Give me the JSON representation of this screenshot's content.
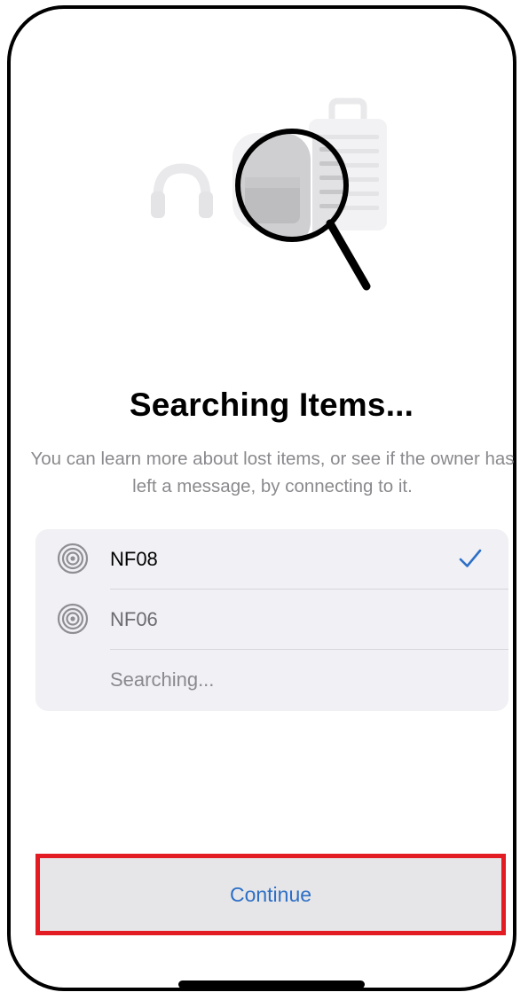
{
  "screen": {
    "title": "Searching Items...",
    "description": "You can learn more about lost items, or see if the owner has left a message, by connecting to it."
  },
  "hero_icons": [
    "headphones-icon",
    "backpack-icon",
    "suitcase-icon",
    "magnifier-icon"
  ],
  "items": [
    {
      "name": "NF08",
      "icon": "radar-icon",
      "selected": true
    },
    {
      "name": "NF06",
      "icon": "radar-icon",
      "selected": false
    }
  ],
  "status": {
    "searching_label": "Searching..."
  },
  "actions": {
    "continue_label": "Continue"
  },
  "colors": {
    "accent": "#2d6fc6",
    "highlight": "#e31b23",
    "list_background": "#f0f0f5",
    "secondary_text": "#8a8a8e"
  }
}
